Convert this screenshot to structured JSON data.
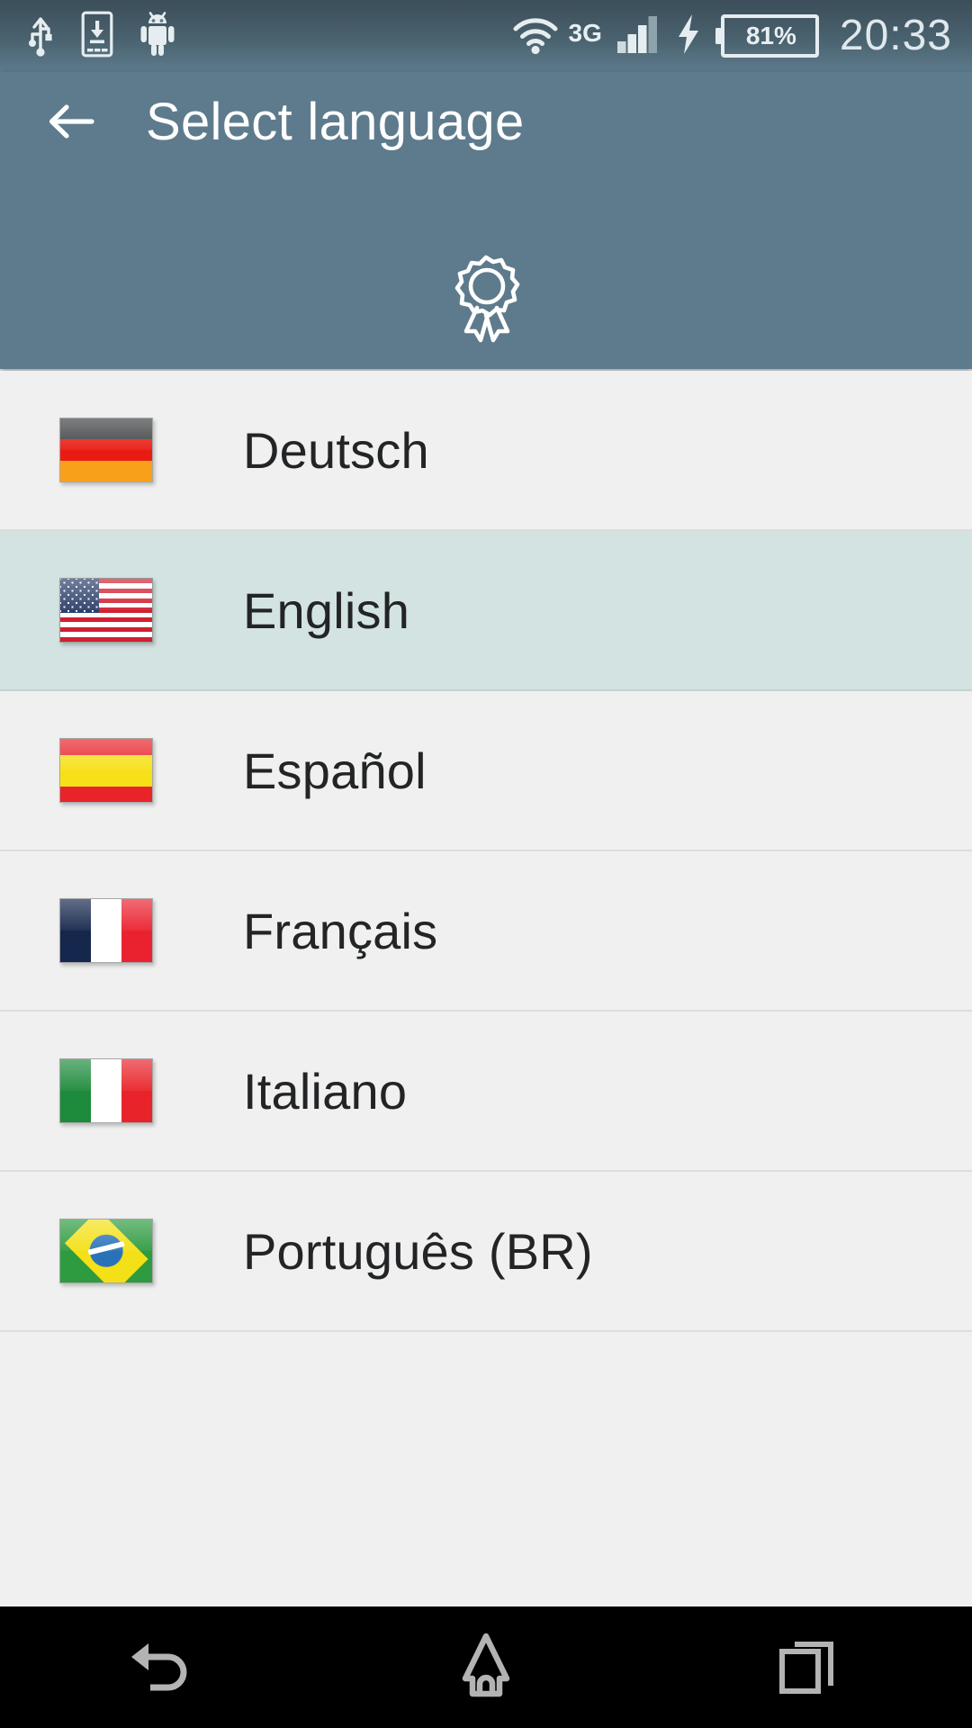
{
  "statusbar": {
    "left_icons": [
      {
        "name": "usb-icon",
        "label": "USB connected"
      },
      {
        "name": "download-to-device-icon",
        "label": "Download to device"
      },
      {
        "name": "android-robot-icon",
        "label": "Android system"
      }
    ],
    "wifi_icon": "wifi-icon",
    "network_type": "3G",
    "signal_icon": "cellular-signal-icon",
    "signal_bars_filled": 3,
    "signal_bars_total": 4,
    "charging_icon": "charging-bolt-icon",
    "battery_percent": "81%",
    "time": "20:33"
  },
  "appbar": {
    "back_icon": "back-arrow-icon",
    "title": "Select language",
    "badge_icon": "award-ribbon-icon",
    "background_color": "#5d7b8c"
  },
  "list": {
    "selected_color": "#d3e3e1",
    "background_color": "#eff0ef",
    "items": [
      {
        "label": "Deutsch",
        "flag": "flag-germany",
        "selected": false
      },
      {
        "label": "English",
        "flag": "flag-united-states",
        "selected": true
      },
      {
        "label": "Español",
        "flag": "flag-spain",
        "selected": false
      },
      {
        "label": "Français",
        "flag": "flag-france",
        "selected": false
      },
      {
        "label": "Italiano",
        "flag": "flag-italy",
        "selected": false
      },
      {
        "label": "Português (BR)",
        "flag": "flag-brazil",
        "selected": false
      }
    ]
  },
  "navbar": {
    "buttons": [
      {
        "name": "nav-back-button",
        "icon": "back-icon"
      },
      {
        "name": "nav-home-button",
        "icon": "home-icon"
      },
      {
        "name": "nav-recents-button",
        "icon": "recents-icon"
      }
    ]
  }
}
